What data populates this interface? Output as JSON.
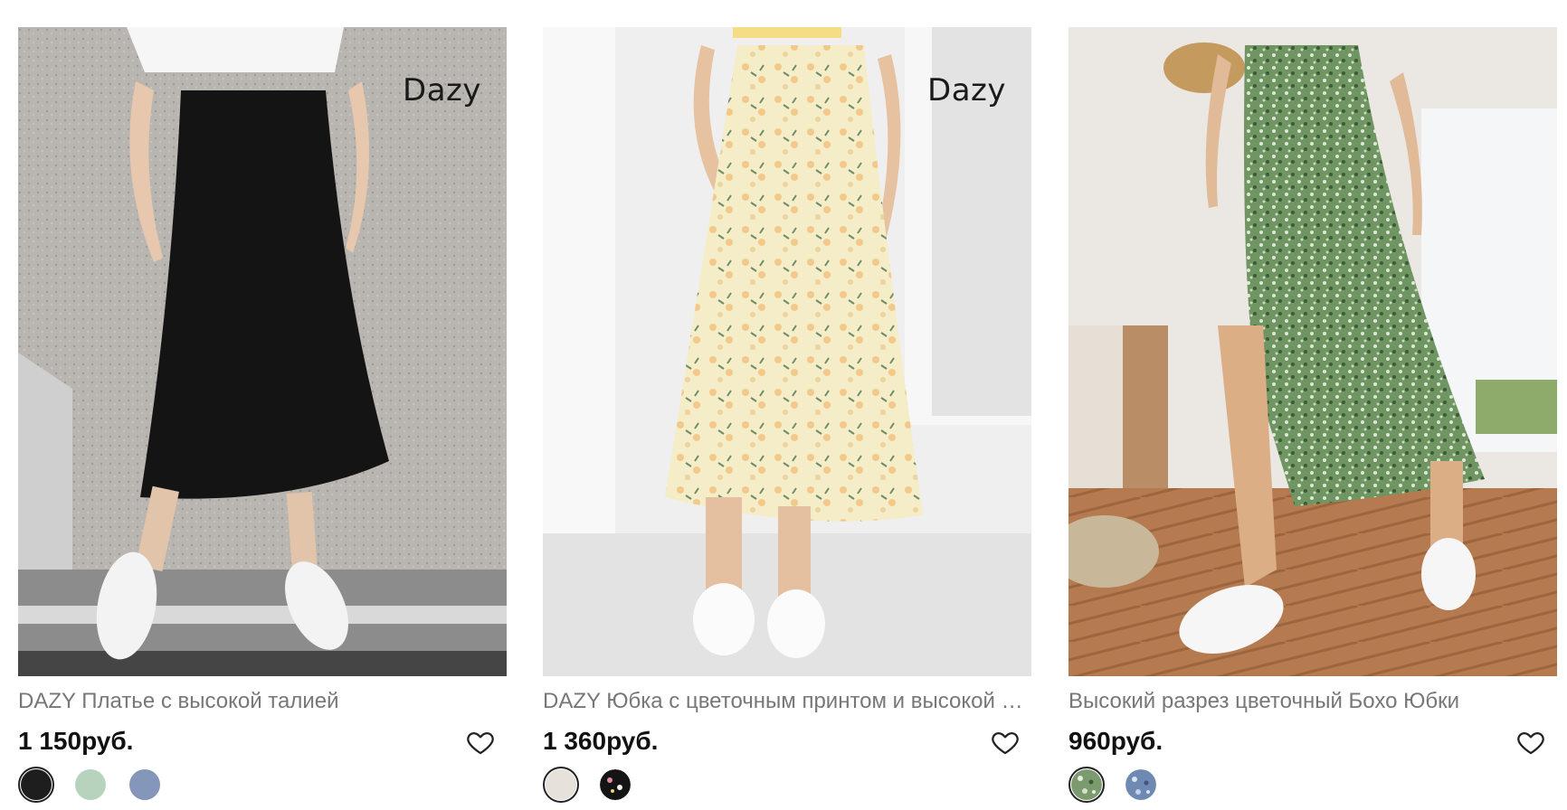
{
  "products": [
    {
      "brand_mark": "Dazy",
      "title": "DAZY Платье с высокой талией",
      "price": "1 150руб.",
      "swatches": [
        {
          "color": "#1e1e1e",
          "pattern": "solid",
          "selected": true
        },
        {
          "color": "#b7d3bd",
          "pattern": "solid",
          "selected": false
        },
        {
          "color": "#8497ba",
          "pattern": "solid",
          "selected": false
        }
      ],
      "image": {
        "background": "#b9b6b1",
        "skirt": "#141414"
      }
    },
    {
      "brand_mark": "Dazy",
      "title": "DAZY Юбка с цветочным принтом и высокой талией",
      "price": "1 360руб.",
      "swatches": [
        {
          "color": "#e6e2da",
          "pattern": "solid",
          "selected": true
        },
        {
          "color": "#141414",
          "pattern": "floral-dark",
          "selected": false
        }
      ],
      "image": {
        "background": "#ececec",
        "skirt": "#f4edc8"
      }
    },
    {
      "brand_mark": "",
      "title": "Высокий разрез цветочный Бохо Юбки",
      "price": "960руб.",
      "swatches": [
        {
          "color": "#7b9a6e",
          "pattern": "floral-green",
          "selected": true
        },
        {
          "color": "#6f8ab2",
          "pattern": "floral-blue",
          "selected": false
        }
      ],
      "image": {
        "background": "#e9e6e1",
        "skirt": "#7fa06f"
      }
    }
  ],
  "icons": {
    "wishlist": "heart-outline-icon"
  }
}
